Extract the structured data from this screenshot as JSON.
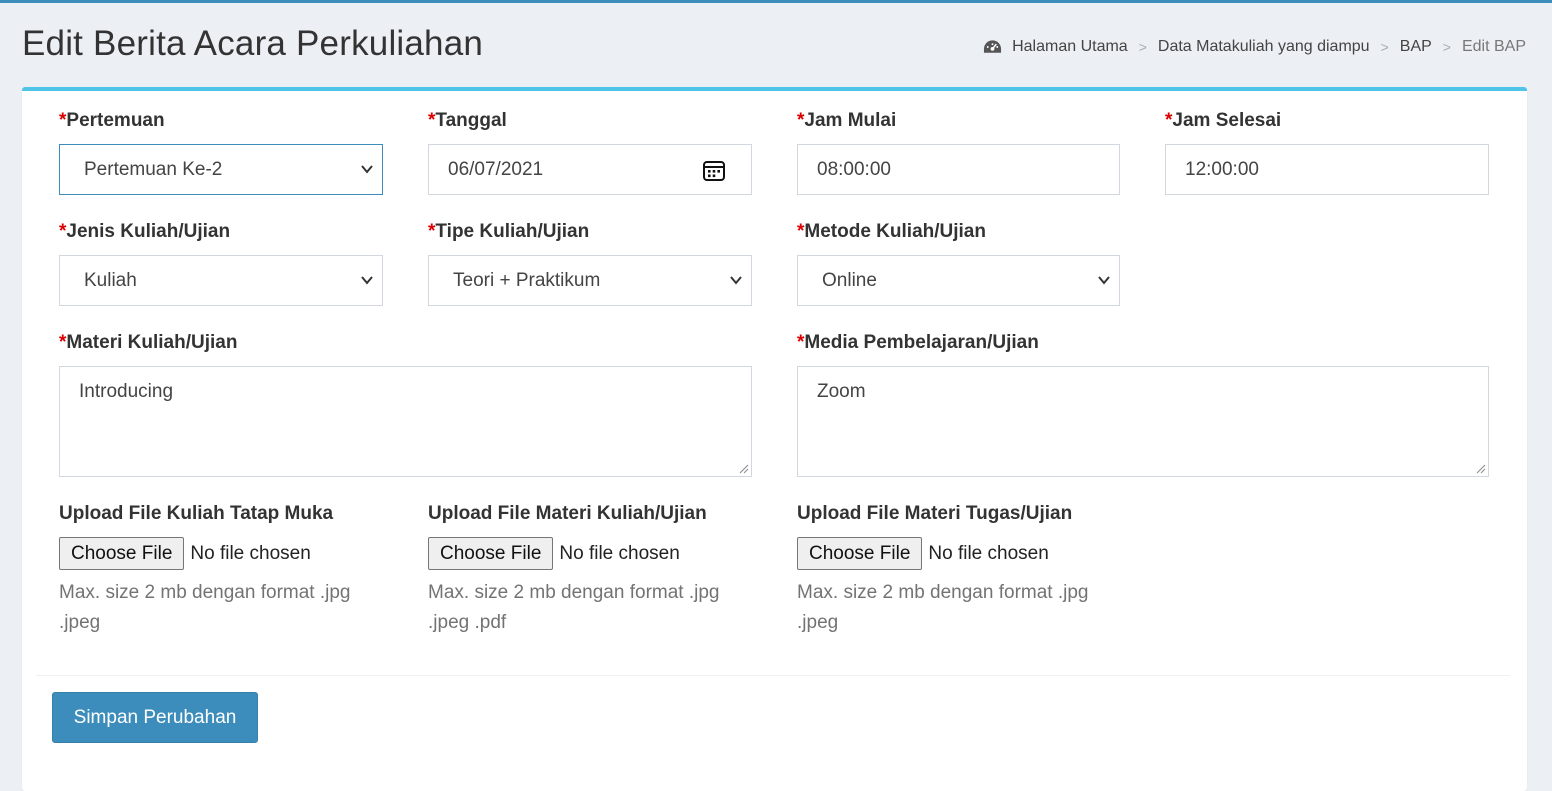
{
  "page": {
    "title": "Edit Berita Acara Perkuliahan"
  },
  "breadcrumb": {
    "items": [
      "Halaman Utama",
      "Data Matakuliah yang diampu",
      "BAP",
      "Edit BAP"
    ],
    "icon": "dashboard-icon"
  },
  "form": {
    "required_mark": "*",
    "pertemuan": {
      "label": "Pertemuan",
      "value": "Pertemuan Ke-2"
    },
    "tanggal": {
      "label": "Tanggal",
      "value": "06/07/2021"
    },
    "jam_mulai": {
      "label": "Jam Mulai",
      "value": "08:00:00"
    },
    "jam_selesai": {
      "label": "Jam Selesai",
      "value": "12:00:00"
    },
    "jenis": {
      "label": "Jenis Kuliah/Ujian",
      "value": "Kuliah"
    },
    "tipe": {
      "label": "Tipe Kuliah/Ujian",
      "value": "Teori + Praktikum"
    },
    "metode": {
      "label": "Metode Kuliah/Ujian",
      "value": "Online"
    },
    "materi": {
      "label": "Materi Kuliah/Ujian",
      "value": "Introducing"
    },
    "media": {
      "label": "Media Pembelajaran/Ujian",
      "value": "Zoom"
    },
    "uploads": [
      {
        "label": "Upload File Kuliah Tatap Muka",
        "button": "Choose File",
        "status": "No file chosen",
        "help_line1": "Max. size 2 mb dengan format .jpg",
        "help_line2": ".jpeg"
      },
      {
        "label": "Upload File Materi Kuliah/Ujian",
        "button": "Choose File",
        "status": "No file chosen",
        "help_line1": "Max. size 2 mb dengan format .jpg",
        "help_line2": ".jpeg .pdf"
      },
      {
        "label": "Upload File Materi Tugas/Ujian",
        "button": "Choose File",
        "status": "No file chosen",
        "help_line1": "Max. size 2 mb dengan format .jpg",
        "help_line2": ".jpeg"
      }
    ],
    "submit_label": "Simpan Perubahan"
  },
  "colors": {
    "accent": "#3c8dbc",
    "box_border": "#4fc3e8",
    "required": "#dd0000",
    "background": "#ecf0f5"
  }
}
